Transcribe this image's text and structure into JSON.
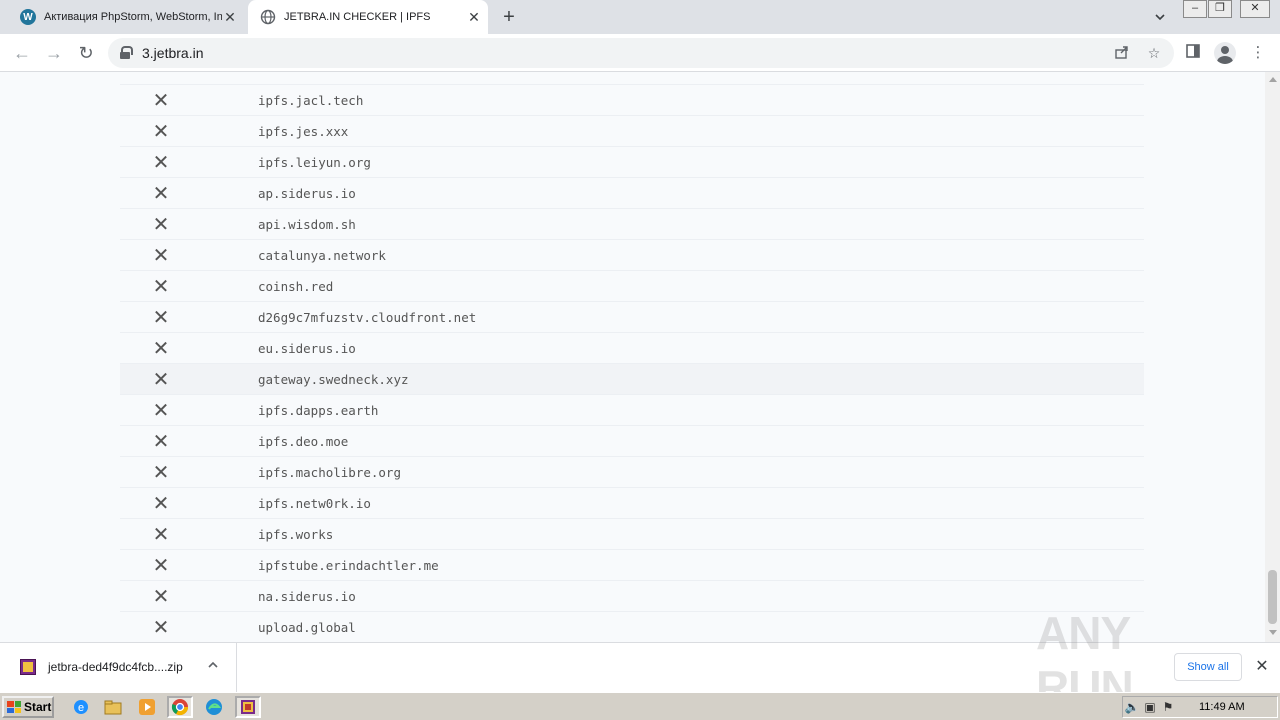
{
  "tabs": [
    {
      "title": "Активация PhpStorm, WebStorm, IntelliJ",
      "icon": "wordpress-icon"
    },
    {
      "title": "JETBRA.IN CHECKER | IPFS",
      "icon": "globe-icon"
    }
  ],
  "address_bar": {
    "url": "3.jetbra.in"
  },
  "hosts": [
    "ipfs.jacl.tech",
    "ipfs.jes.xxx",
    "ipfs.leiyun.org",
    "ap.siderus.io",
    "api.wisdom.sh",
    "catalunya.network",
    "coinsh.red",
    "d26g9c7mfuzstv.cloudfront.net",
    "eu.siderus.io",
    "gateway.swedneck.xyz",
    "ipfs.dapps.earth",
    "ipfs.deo.moe",
    "ipfs.macholibre.org",
    "ipfs.netw0rk.io",
    "ipfs.works",
    "ipfstube.erindachtler.me",
    "na.siderus.io",
    "upload.global"
  ],
  "downloads": {
    "file_name": "jetbra-ded4f9dc4fcb....zip",
    "show_all": "Show all"
  },
  "taskbar": {
    "start": "Start",
    "clock": "11:49 AM"
  },
  "watermark": "ANY RUN",
  "colors": {
    "row_highlight": "#f1f3f6",
    "page_bg": "#f8fafc",
    "link_blue": "#1a73e8"
  }
}
